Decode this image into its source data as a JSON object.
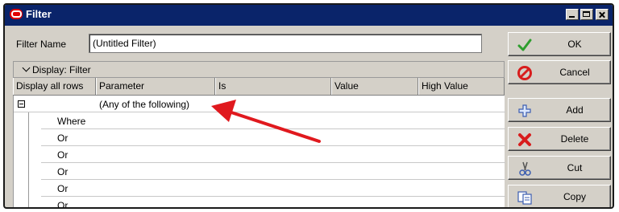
{
  "window": {
    "title": "Filter"
  },
  "form": {
    "filter_name_label": "Filter Name",
    "filter_name_value": "(Untitled Filter)"
  },
  "panel": {
    "title": "Display: Filter"
  },
  "grid": {
    "columns": [
      "Display all rows",
      "Parameter",
      "Is",
      "Value",
      "High Value"
    ],
    "group_label": "(Any of the following)",
    "conditions": [
      "Where",
      "Or",
      "Or",
      "Or",
      "Or",
      "Or"
    ]
  },
  "buttons": {
    "ok": "OK",
    "cancel": "Cancel",
    "add": "Add",
    "delete": "Delete",
    "cut": "Cut",
    "copy": "Copy"
  },
  "colors": {
    "title_bar": "#0a246a",
    "annotation_arrow": "#e0191e",
    "ok_check": "#2e9e2e",
    "cancel_icon": "#d81c1c"
  },
  "icons": {
    "app": "oracle-icon",
    "ok": "checkmark-icon",
    "cancel": "no-entry-icon",
    "add": "plus-icon",
    "delete": "x-icon",
    "cut": "scissors-icon",
    "copy": "copy-icon"
  }
}
